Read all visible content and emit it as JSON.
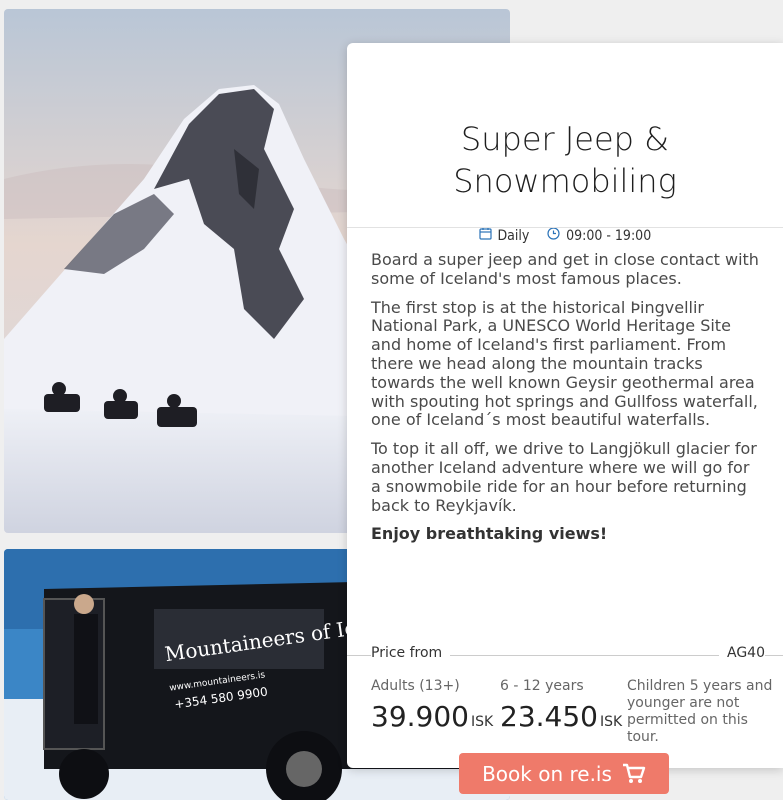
{
  "tour": {
    "title_line1": "Super Jeep &",
    "title_line2": "Snowmobiling",
    "schedule": {
      "days": "Daily",
      "time": "09:00 - 19:00"
    },
    "description": [
      "Board a super jeep and get in close contact with some of Iceland's most famous places.",
      "The first stop is at the historical Þingvellir National Park, a UNESCO World Heritage Site and home of Iceland's first parliament. From there we head along the mountain tracks towards the well known Geysir geothermal area with spouting hot springs and Gullfoss waterfall, one of Iceland´s most beautiful waterfalls.",
      "To top it all off, we drive to Langjökull glacier for another Iceland adventure where we will go for a snowmobile ride for an hour before returning back to Reykjavík."
    ],
    "highlight": "Enjoy breathtaking views!",
    "price": {
      "label": "Price from",
      "code": "AG40",
      "adults_label": "Adults (13+)",
      "adults_amount": "39.900",
      "child_label": "6 - 12 years",
      "child_amount": "23.450",
      "currency": "ISK",
      "note": "Children 5 years and younger are not permitted on this tour."
    },
    "book_label": "Book on re.is"
  },
  "jeep_sign": {
    "brand": "Mountaineers of Ic",
    "url": "www.mountaineers.is",
    "phone": "+354 580 9900"
  },
  "icons": {
    "calendar": "calendar-icon",
    "clock": "clock-icon",
    "cart": "cart-icon"
  },
  "colors": {
    "accent": "#2b73b8",
    "book_button": "#ef7a6a"
  }
}
